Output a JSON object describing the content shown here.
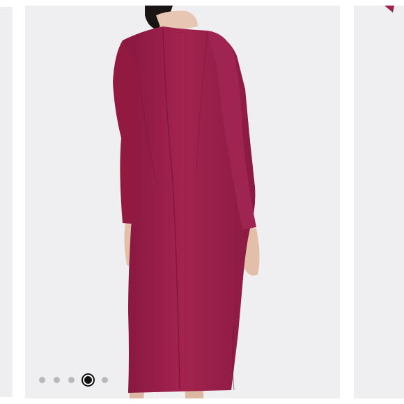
{
  "gallery": {
    "main_image": {
      "icon": "dress-back-view-image",
      "dress_color": "#9c1f4e"
    },
    "pagination": {
      "count": 5,
      "active_index": 3
    }
  }
}
